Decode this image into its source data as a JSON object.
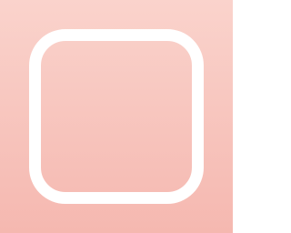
{
  "colors": {
    "background_top": "#FAD3CC",
    "background_bottom": "#F5B8B0",
    "frame": "#FFFFFF"
  },
  "icon": {
    "name": "rounded-square-outline-icon"
  }
}
